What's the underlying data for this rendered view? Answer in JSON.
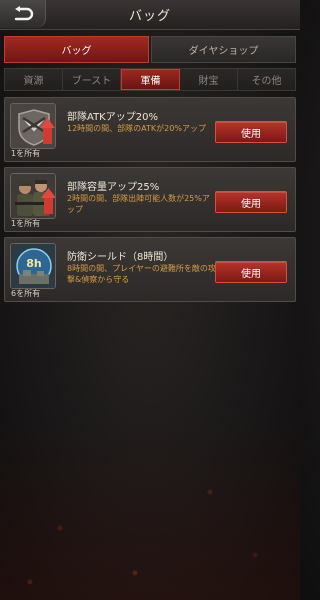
{
  "header": {
    "title": "バッグ"
  },
  "main_tabs": [
    {
      "label": "バッグ",
      "active": true
    },
    {
      "label": "ダイヤショップ",
      "active": false
    }
  ],
  "sub_tabs": [
    {
      "label": "資源",
      "active": false
    },
    {
      "label": "ブースト",
      "active": false
    },
    {
      "label": "軍備",
      "active": true
    },
    {
      "label": "財宝",
      "active": false
    },
    {
      "label": "その他",
      "active": false
    }
  ],
  "items": [
    {
      "title": "部隊ATKアップ20%",
      "desc": "12時間の間、部隊のATKが20%アップ",
      "owned": "1を所有",
      "button": "使用",
      "icon": "atk-boost-icon"
    },
    {
      "title": "部隊容量アップ25%",
      "desc": "2時間の間、部隊出陣可能人数が25%アップ",
      "owned": "1を所有",
      "button": "使用",
      "icon": "soldiers-icon"
    },
    {
      "title": "防衛シールド（8時間）",
      "desc": "8時間の間、プレイヤーの避難所を敵の攻撃&偵察から守る",
      "owned": "6を所有",
      "button": "使用",
      "icon": "shield-8h-icon",
      "icon_label": "8h"
    }
  ],
  "colors": {
    "accent_red": "#a12a22",
    "desc_orange": "#d49a45"
  }
}
